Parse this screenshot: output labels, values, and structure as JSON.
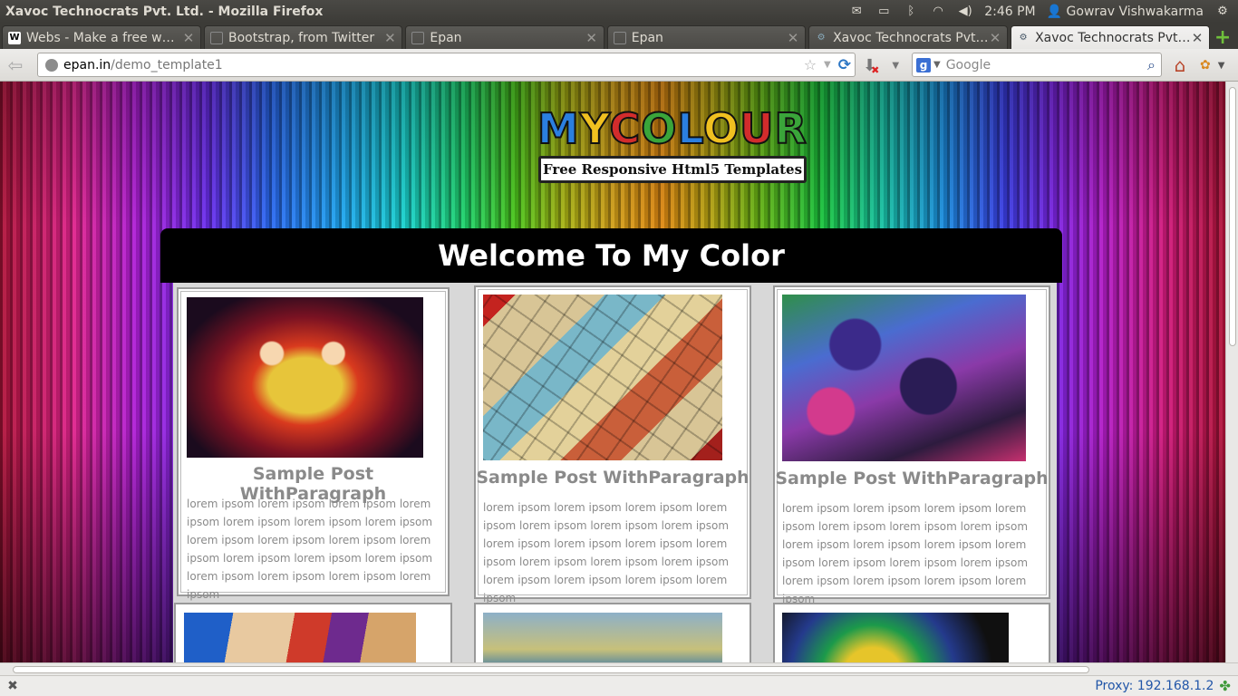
{
  "os": {
    "window_title": "Xavoc Technocrats Pvt. Ltd. - Mozilla Firefox",
    "time": "2:46 PM",
    "user": "Gowrav Vishwakarma",
    "icons": [
      "mail-icon",
      "battery-icon",
      "bluetooth-icon",
      "wifi-icon",
      "volume-icon",
      "user-icon",
      "gear-icon"
    ]
  },
  "tabs": [
    {
      "label": "Webs - Make a free web...",
      "favicon": "W",
      "active": false
    },
    {
      "label": "Bootstrap, from Twitter",
      "favicon": "",
      "active": false
    },
    {
      "label": "Epan",
      "favicon": "",
      "active": false
    },
    {
      "label": "Epan",
      "favicon": "",
      "active": false
    },
    {
      "label": "Xavoc Technocrats Pvt ...",
      "favicon": "",
      "active": false
    },
    {
      "label": "Xavoc Technocrats Pvt. ...",
      "favicon": "",
      "active": true
    }
  ],
  "nav": {
    "url_host": "epan.in",
    "url_path": "/demo_template1",
    "search_placeholder": "Google",
    "search_engine_letter": "g"
  },
  "page": {
    "logo_text": "MYCOLOUR",
    "logo_tagline": "Free Responsive Html5 Templates",
    "welcome": "Welcome To My Color",
    "posts": [
      {
        "title": "Sample Post WithParagraph",
        "text": "lorem ipsom lorem ipsom lorem ipsom lorem ipsom lorem ipsom lorem ipsom lorem ipsom lorem ipsom lorem ipsom lorem ipsom lorem ipsom lorem ipsom lorem ipsom lorem ipsom lorem ipsom lorem ipsom lorem ipsom lorem ipsom"
      },
      {
        "title": "Sample Post WithParagraph",
        "text": "lorem ipsom lorem ipsom lorem ipsom lorem ipsom lorem ipsom lorem ipsom lorem ipsom lorem ipsom lorem ipsom lorem ipsom lorem ipsom lorem ipsom lorem ipsom lorem ipsom lorem ipsom lorem ipsom lorem ipsom lorem ipsom"
      },
      {
        "title": "Sample Post WithParagraph",
        "text": "lorem ipsom lorem ipsom lorem ipsom lorem ipsom lorem ipsom lorem ipsom lorem ipsom lorem ipsom lorem ipsom lorem ipsom lorem ipsom lorem ipsom lorem ipsom lorem ipsom lorem ipsom lorem ipsom lorem ipsom lorem ipsom"
      }
    ]
  },
  "status": {
    "proxy": "Proxy: 192.168.1.2"
  }
}
